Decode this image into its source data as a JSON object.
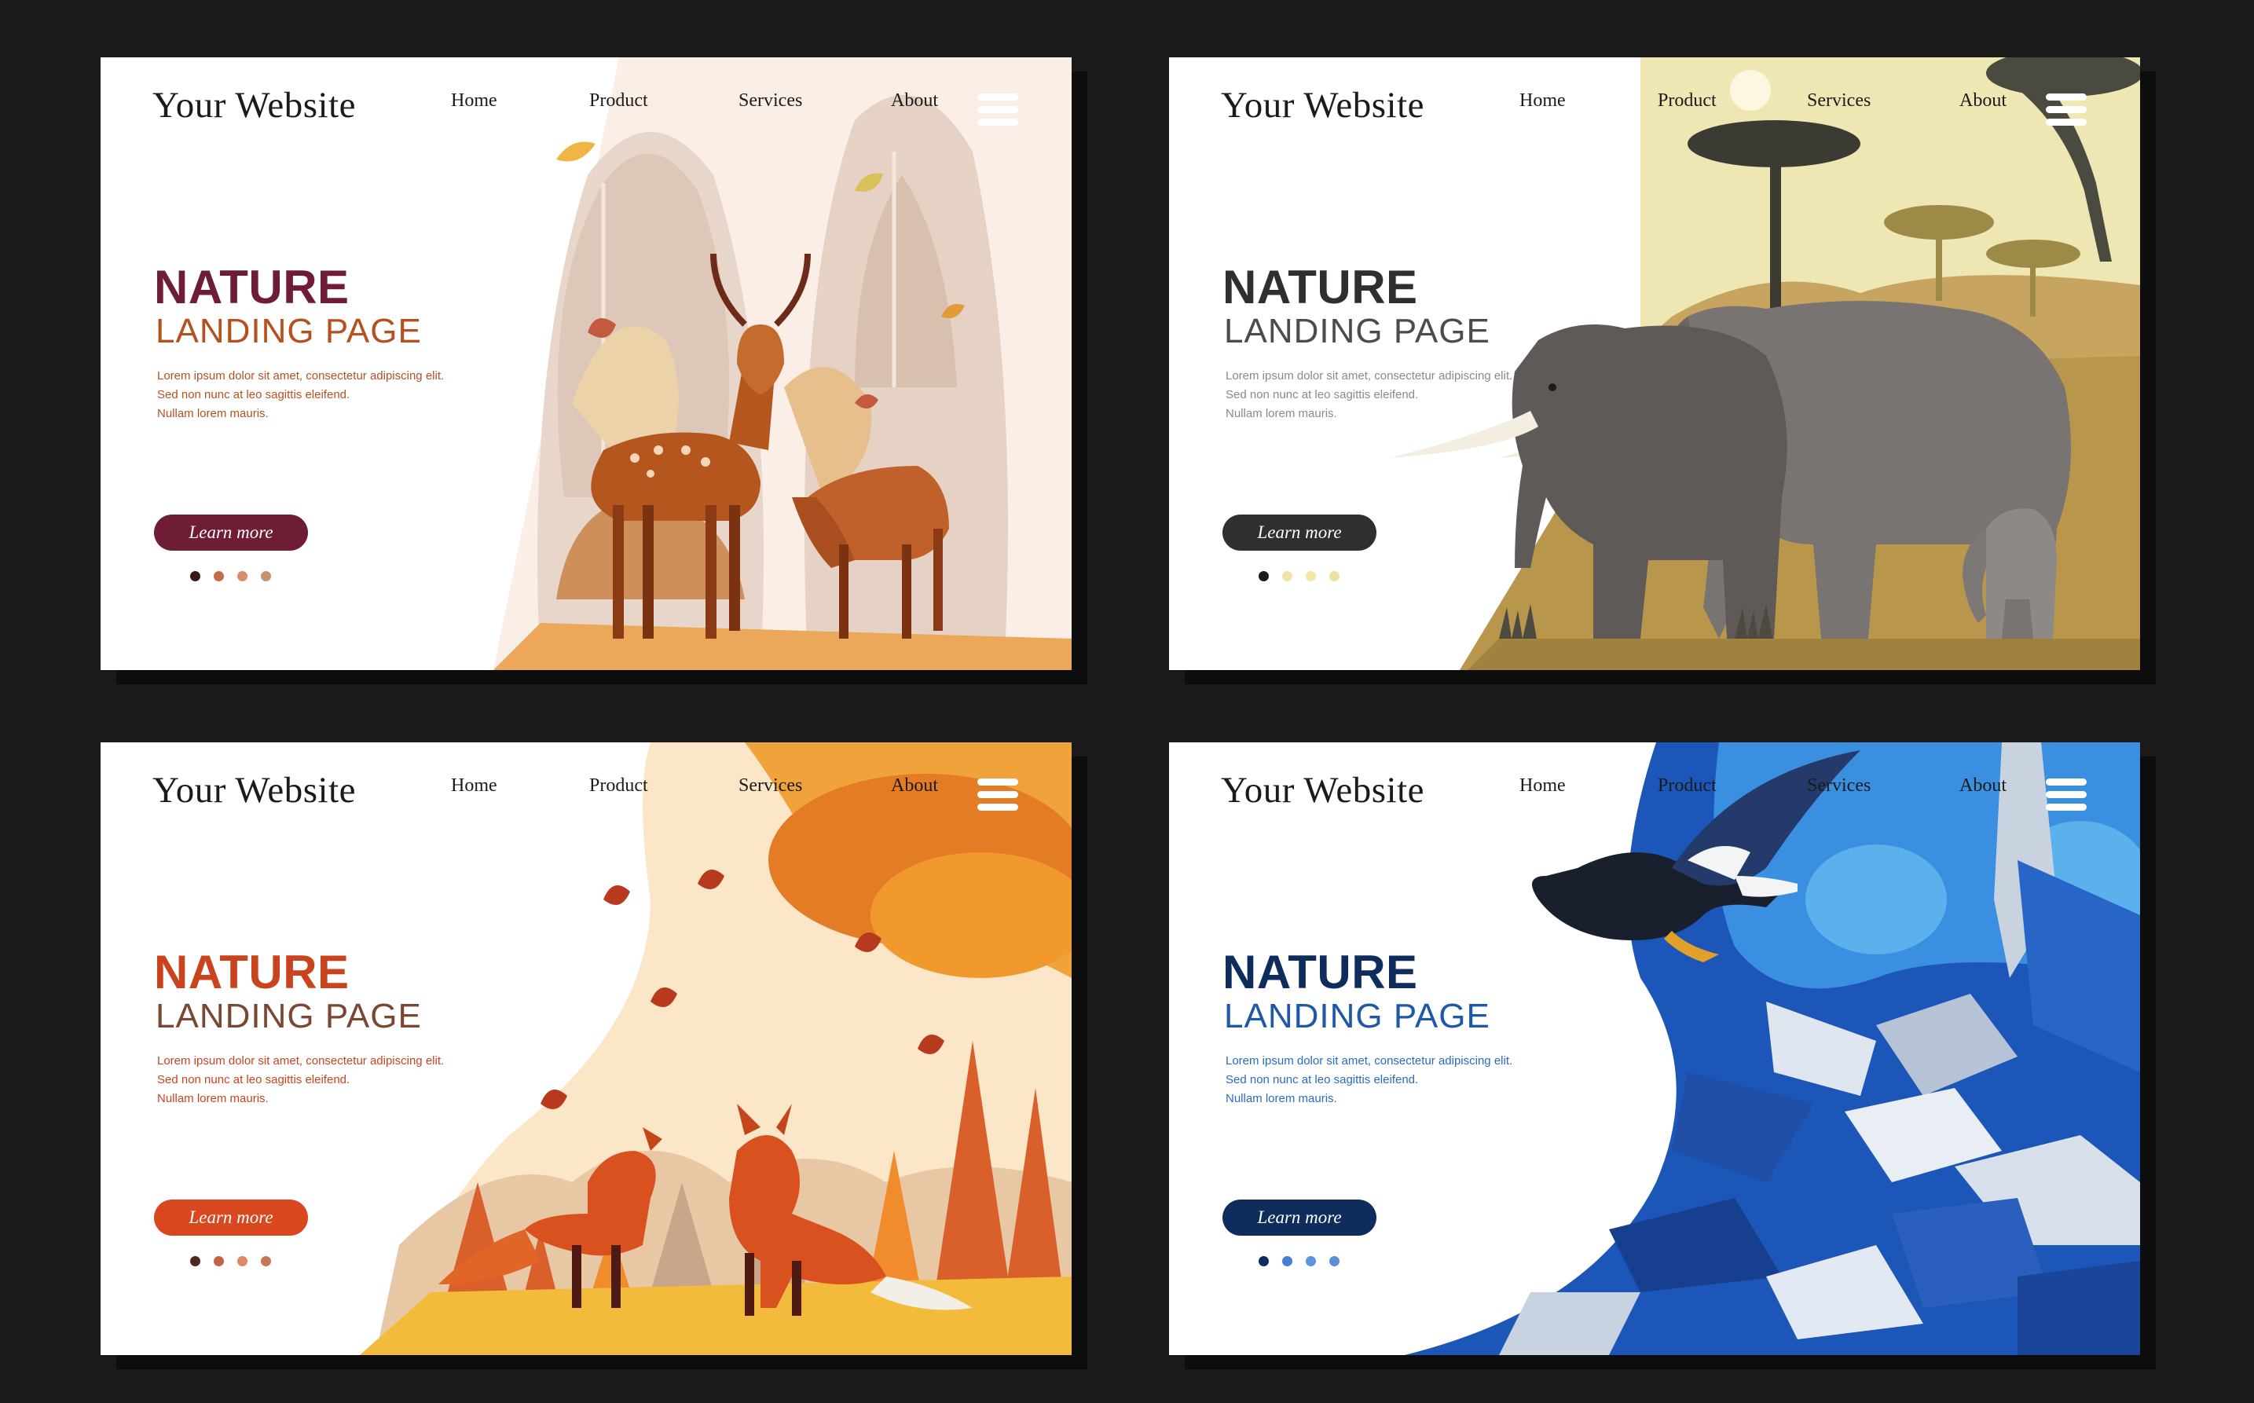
{
  "cards": [
    {
      "brand": "Your Website",
      "nav": [
        "Home",
        "Product",
        "Services",
        "About"
      ],
      "title1": "NATURE",
      "title2": "LANDING PAGE",
      "desc": [
        "Lorem ipsum dolor sit amet, consectetur adipiscing elit.",
        "Sed non nunc at leo sagittis eleifend.",
        "Nullam lorem mauris."
      ],
      "button": "Learn more",
      "theme": {
        "title1": "#6e1d35",
        "title2": "#b5501f",
        "desc": "#b5501f",
        "button": "#6e1d35",
        "dots": [
          "#3b1a16",
          "#c56a4a",
          "#d88e6c",
          "#c5946e"
        ]
      },
      "illustration": "deer-in-autumn-forest"
    },
    {
      "brand": "Your Website",
      "nav": [
        "Home",
        "Product",
        "Services",
        "About"
      ],
      "title1": "NATURE",
      "title2": "LANDING PAGE",
      "desc": [
        "Lorem ipsum dolor sit amet, consectetur adipiscing elit.",
        "Sed non nunc at leo sagittis eleifend.",
        "Nullam lorem mauris."
      ],
      "button": "Learn more",
      "theme": {
        "title1": "#2e302d",
        "title2": "#4a4d48",
        "desc": "#8a8a86",
        "button": "#2e302d",
        "dots": [
          "#1b1b1b",
          "#efe3a6",
          "#f2e6a8",
          "#ece19e"
        ]
      },
      "illustration": "elephants-in-savanna"
    },
    {
      "brand": "Your Website",
      "nav": [
        "Home",
        "Product",
        "Services",
        "About"
      ],
      "title1": "NATURE",
      "title2": "LANDING PAGE",
      "desc": [
        "Lorem ipsum dolor sit amet, consectetur adipiscing elit.",
        "Sed non nunc at leo sagittis eleifend.",
        "Nullam lorem mauris."
      ],
      "button": "Learn more",
      "theme": {
        "title1": "#c9431f",
        "title2": "#7a4733",
        "desc": "#c9431f",
        "button": "#d9471f",
        "dots": [
          "#4a2a1e",
          "#c26348",
          "#dc8a65",
          "#c87756"
        ]
      },
      "illustration": "foxes-in-autumn"
    },
    {
      "brand": "Your Website",
      "nav": [
        "Home",
        "Product",
        "Services",
        "About"
      ],
      "title1": "NATURE",
      "title2": "LANDING PAGE",
      "desc": [
        "Lorem ipsum dolor sit amet, consectetur adipiscing elit.",
        "Sed non nunc at leo sagittis eleifend.",
        "Nullam lorem mauris."
      ],
      "button": "Learn more",
      "theme": {
        "title1": "#0f2d5c",
        "title2": "#1e58a6",
        "desc": "#2a6bc0",
        "button": "#0f2d5c",
        "dots": [
          "#0f2d5c",
          "#4a7fd0",
          "#5d94e0",
          "#5c8fd8"
        ]
      },
      "illustration": "eagle-over-mountains"
    }
  ]
}
